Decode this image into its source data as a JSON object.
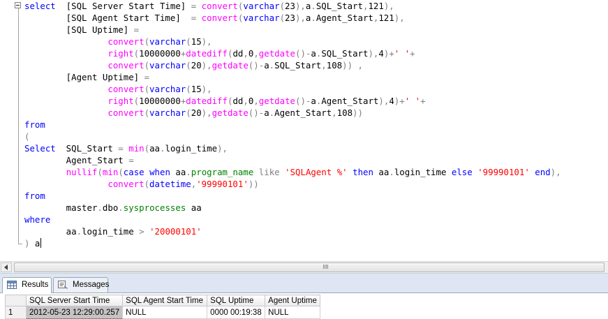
{
  "editor": {
    "lines": [
      [
        {
          "t": "kw",
          "v": "select"
        },
        {
          "t": "tx",
          "v": "  "
        },
        {
          "t": "tx",
          "v": "[SQL Server Start Time] "
        },
        {
          "t": "op",
          "v": "="
        },
        {
          "t": "tx",
          "v": " "
        },
        {
          "t": "fn",
          "v": "convert"
        },
        {
          "t": "op",
          "v": "("
        },
        {
          "t": "kw",
          "v": "varchar"
        },
        {
          "t": "op",
          "v": "("
        },
        {
          "t": "tx",
          "v": "23"
        },
        {
          "t": "op",
          "v": "),"
        },
        {
          "t": "tx",
          "v": "a"
        },
        {
          "t": "op",
          "v": "."
        },
        {
          "t": "tx",
          "v": "SQL_Start"
        },
        {
          "t": "op",
          "v": ","
        },
        {
          "t": "tx",
          "v": "121"
        },
        {
          "t": "op",
          "v": "),"
        }
      ],
      [
        {
          "t": "tx",
          "v": "        [SQL Agent Start Time]  "
        },
        {
          "t": "op",
          "v": "="
        },
        {
          "t": "tx",
          "v": " "
        },
        {
          "t": "fn",
          "v": "convert"
        },
        {
          "t": "op",
          "v": "("
        },
        {
          "t": "kw",
          "v": "varchar"
        },
        {
          "t": "op",
          "v": "("
        },
        {
          "t": "tx",
          "v": "23"
        },
        {
          "t": "op",
          "v": "),"
        },
        {
          "t": "tx",
          "v": "a"
        },
        {
          "t": "op",
          "v": "."
        },
        {
          "t": "tx",
          "v": "Agent_Start"
        },
        {
          "t": "op",
          "v": ","
        },
        {
          "t": "tx",
          "v": "121"
        },
        {
          "t": "op",
          "v": "),"
        }
      ],
      [
        {
          "t": "tx",
          "v": "        [SQL Uptime] "
        },
        {
          "t": "op",
          "v": "="
        }
      ],
      [
        {
          "t": "tx",
          "v": "                "
        },
        {
          "t": "fn",
          "v": "convert"
        },
        {
          "t": "op",
          "v": "("
        },
        {
          "t": "kw",
          "v": "varchar"
        },
        {
          "t": "op",
          "v": "("
        },
        {
          "t": "tx",
          "v": "15"
        },
        {
          "t": "op",
          "v": "),"
        }
      ],
      [
        {
          "t": "tx",
          "v": "                "
        },
        {
          "t": "fn",
          "v": "right"
        },
        {
          "t": "op",
          "v": "("
        },
        {
          "t": "tx",
          "v": "10000000"
        },
        {
          "t": "op",
          "v": "+"
        },
        {
          "t": "fn",
          "v": "datediff"
        },
        {
          "t": "op",
          "v": "("
        },
        {
          "t": "tx",
          "v": "dd"
        },
        {
          "t": "op",
          "v": ","
        },
        {
          "t": "tx",
          "v": "0"
        },
        {
          "t": "op",
          "v": ","
        },
        {
          "t": "fn",
          "v": "getdate"
        },
        {
          "t": "op",
          "v": "()-"
        },
        {
          "t": "tx",
          "v": "a"
        },
        {
          "t": "op",
          "v": "."
        },
        {
          "t": "tx",
          "v": "SQL_Start"
        },
        {
          "t": "op",
          "v": "),"
        },
        {
          "t": "tx",
          "v": "4"
        },
        {
          "t": "op",
          "v": ")+"
        },
        {
          "t": "str",
          "v": "' '"
        },
        {
          "t": "op",
          "v": "+"
        }
      ],
      [
        {
          "t": "tx",
          "v": "                "
        },
        {
          "t": "fn",
          "v": "convert"
        },
        {
          "t": "op",
          "v": "("
        },
        {
          "t": "kw",
          "v": "varchar"
        },
        {
          "t": "op",
          "v": "("
        },
        {
          "t": "tx",
          "v": "20"
        },
        {
          "t": "op",
          "v": "),"
        },
        {
          "t": "fn",
          "v": "getdate"
        },
        {
          "t": "op",
          "v": "()-"
        },
        {
          "t": "tx",
          "v": "a"
        },
        {
          "t": "op",
          "v": "."
        },
        {
          "t": "tx",
          "v": "SQL_Start"
        },
        {
          "t": "op",
          "v": ","
        },
        {
          "t": "tx",
          "v": "108"
        },
        {
          "t": "op",
          "v": "))"
        },
        {
          "t": "tx",
          "v": " "
        },
        {
          "t": "op",
          "v": ","
        }
      ],
      [
        {
          "t": "tx",
          "v": "        [Agent Uptime] "
        },
        {
          "t": "op",
          "v": "="
        }
      ],
      [
        {
          "t": "tx",
          "v": "                "
        },
        {
          "t": "fn",
          "v": "convert"
        },
        {
          "t": "op",
          "v": "("
        },
        {
          "t": "kw",
          "v": "varchar"
        },
        {
          "t": "op",
          "v": "("
        },
        {
          "t": "tx",
          "v": "15"
        },
        {
          "t": "op",
          "v": "),"
        }
      ],
      [
        {
          "t": "tx",
          "v": "                "
        },
        {
          "t": "fn",
          "v": "right"
        },
        {
          "t": "op",
          "v": "("
        },
        {
          "t": "tx",
          "v": "10000000"
        },
        {
          "t": "op",
          "v": "+"
        },
        {
          "t": "fn",
          "v": "datediff"
        },
        {
          "t": "op",
          "v": "("
        },
        {
          "t": "tx",
          "v": "dd"
        },
        {
          "t": "op",
          "v": ","
        },
        {
          "t": "tx",
          "v": "0"
        },
        {
          "t": "op",
          "v": ","
        },
        {
          "t": "fn",
          "v": "getdate"
        },
        {
          "t": "op",
          "v": "()-"
        },
        {
          "t": "tx",
          "v": "a"
        },
        {
          "t": "op",
          "v": "."
        },
        {
          "t": "tx",
          "v": "Agent_Start"
        },
        {
          "t": "op",
          "v": "),"
        },
        {
          "t": "tx",
          "v": "4"
        },
        {
          "t": "op",
          "v": ")+"
        },
        {
          "t": "str",
          "v": "' '"
        },
        {
          "t": "op",
          "v": "+"
        }
      ],
      [
        {
          "t": "tx",
          "v": "                "
        },
        {
          "t": "fn",
          "v": "convert"
        },
        {
          "t": "op",
          "v": "("
        },
        {
          "t": "kw",
          "v": "varchar"
        },
        {
          "t": "op",
          "v": "("
        },
        {
          "t": "tx",
          "v": "20"
        },
        {
          "t": "op",
          "v": "),"
        },
        {
          "t": "fn",
          "v": "getdate"
        },
        {
          "t": "op",
          "v": "()-"
        },
        {
          "t": "tx",
          "v": "a"
        },
        {
          "t": "op",
          "v": "."
        },
        {
          "t": "tx",
          "v": "Agent_Start"
        },
        {
          "t": "op",
          "v": ","
        },
        {
          "t": "tx",
          "v": "108"
        },
        {
          "t": "op",
          "v": "))"
        }
      ],
      [
        {
          "t": "kw",
          "v": "from"
        }
      ],
      [
        {
          "t": "op",
          "v": "("
        }
      ],
      [
        {
          "t": "kw",
          "v": "Select"
        },
        {
          "t": "tx",
          "v": "  SQL_Start "
        },
        {
          "t": "op",
          "v": "="
        },
        {
          "t": "tx",
          "v": " "
        },
        {
          "t": "fn",
          "v": "min"
        },
        {
          "t": "op",
          "v": "("
        },
        {
          "t": "tx",
          "v": "aa"
        },
        {
          "t": "op",
          "v": "."
        },
        {
          "t": "tx",
          "v": "login_time"
        },
        {
          "t": "op",
          "v": "),"
        }
      ],
      [
        {
          "t": "tx",
          "v": "        Agent_Start "
        },
        {
          "t": "op",
          "v": "="
        }
      ],
      [
        {
          "t": "tx",
          "v": "        "
        },
        {
          "t": "fn",
          "v": "nullif"
        },
        {
          "t": "op",
          "v": "("
        },
        {
          "t": "fn",
          "v": "min"
        },
        {
          "t": "op",
          "v": "("
        },
        {
          "t": "kw",
          "v": "case"
        },
        {
          "t": "tx",
          "v": " "
        },
        {
          "t": "kw",
          "v": "when"
        },
        {
          "t": "tx",
          "v": " aa"
        },
        {
          "t": "op",
          "v": "."
        },
        {
          "t": "sys",
          "v": "program_name"
        },
        {
          "t": "tx",
          "v": " "
        },
        {
          "t": "op",
          "v": "like"
        },
        {
          "t": "tx",
          "v": " "
        },
        {
          "t": "str",
          "v": "'SQLAgent %'"
        },
        {
          "t": "tx",
          "v": " "
        },
        {
          "t": "kw",
          "v": "then"
        },
        {
          "t": "tx",
          "v": " aa"
        },
        {
          "t": "op",
          "v": "."
        },
        {
          "t": "tx",
          "v": "login_time "
        },
        {
          "t": "kw",
          "v": "else"
        },
        {
          "t": "tx",
          "v": " "
        },
        {
          "t": "str",
          "v": "'99990101'"
        },
        {
          "t": "tx",
          "v": " "
        },
        {
          "t": "kw",
          "v": "end"
        },
        {
          "t": "op",
          "v": "),"
        }
      ],
      [
        {
          "t": "tx",
          "v": "                "
        },
        {
          "t": "fn",
          "v": "convert"
        },
        {
          "t": "op",
          "v": "("
        },
        {
          "t": "kw",
          "v": "datetime"
        },
        {
          "t": "op",
          "v": ","
        },
        {
          "t": "str",
          "v": "'99990101'"
        },
        {
          "t": "op",
          "v": "))"
        }
      ],
      [
        {
          "t": "kw",
          "v": "from"
        }
      ],
      [
        {
          "t": "tx",
          "v": "        master"
        },
        {
          "t": "op",
          "v": "."
        },
        {
          "t": "tx",
          "v": "dbo"
        },
        {
          "t": "op",
          "v": "."
        },
        {
          "t": "sys",
          "v": "sysprocesses"
        },
        {
          "t": "tx",
          "v": " aa"
        }
      ],
      [
        {
          "t": "kw",
          "v": "where"
        }
      ],
      [
        {
          "t": "tx",
          "v": "        aa"
        },
        {
          "t": "op",
          "v": "."
        },
        {
          "t": "tx",
          "v": "login_time "
        },
        {
          "t": "op",
          "v": ">"
        },
        {
          "t": "tx",
          "v": " "
        },
        {
          "t": "str",
          "v": "'20000101'"
        }
      ],
      [
        {
          "t": "op",
          "v": ")"
        },
        {
          "t": "tx",
          "v": " a"
        }
      ]
    ]
  },
  "tabs": [
    {
      "label": "Results",
      "icon": "grid-icon",
      "active": true
    },
    {
      "label": "Messages",
      "icon": "messages-icon",
      "active": false
    }
  ],
  "results": {
    "columns": [
      "",
      "SQL Server Start Time",
      "SQL Agent Start Time",
      "SQL Uptime",
      "Agent Uptime"
    ],
    "rows": [
      [
        "1",
        "2012-05-23 12:29:00.257",
        "NULL",
        "0000 00:19:38",
        "NULL"
      ]
    ]
  },
  "colors": {
    "keyword": "#0000ff",
    "function": "#ff00ff",
    "string": "#ff0000",
    "operator": "#808080",
    "system_object": "#008000"
  }
}
